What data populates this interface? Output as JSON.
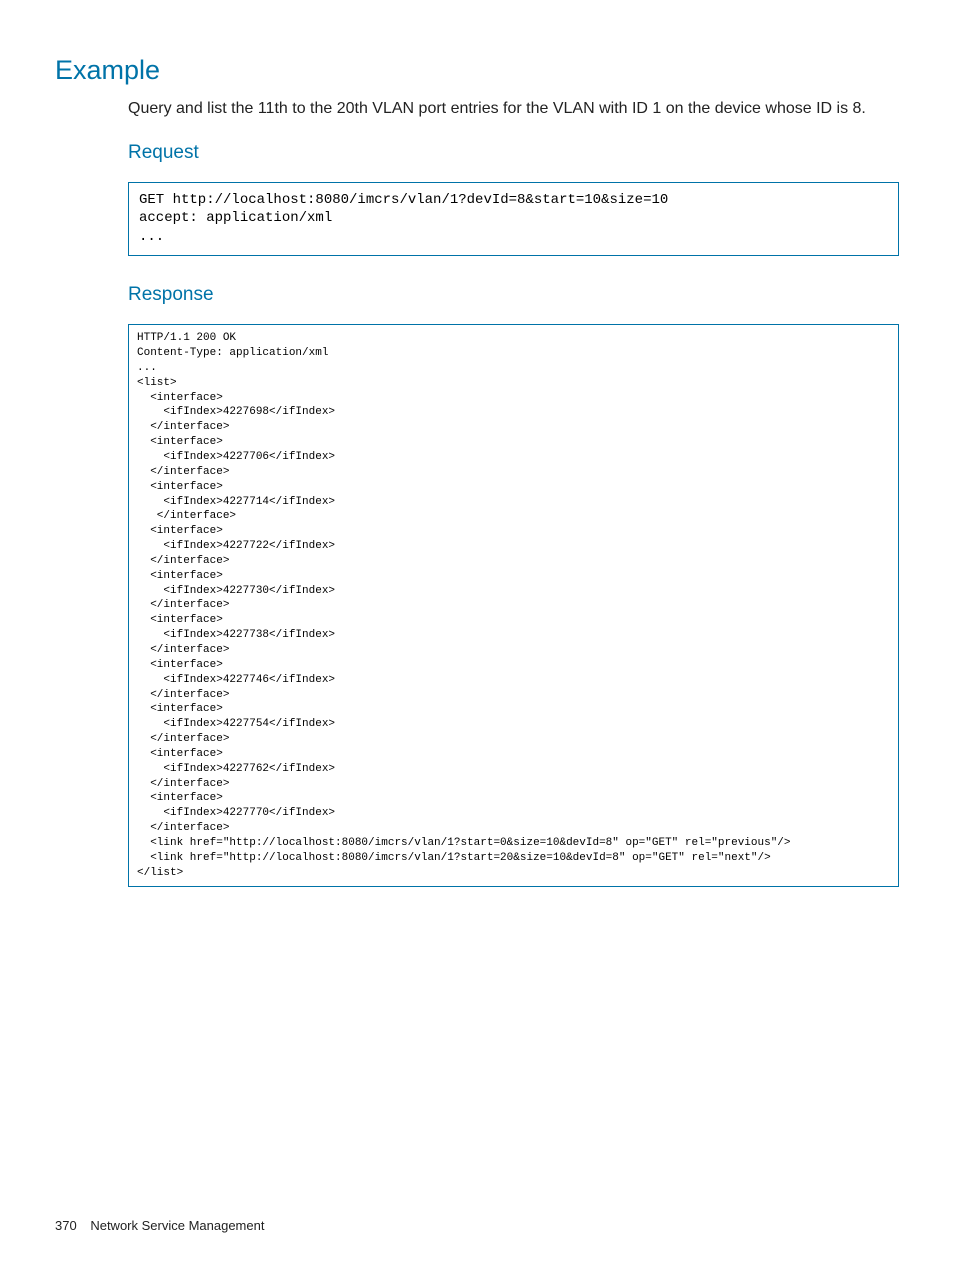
{
  "headings": {
    "example": "Example",
    "request": "Request",
    "response": "Response"
  },
  "example_description": "Query and list the 11th to the 20th VLAN port entries for the VLAN with ID 1 on the device whose ID is 8.",
  "request_code": "GET http://localhost:8080/imcrs/vlan/1?devId=8&start=10&size=10\naccept: application/xml\n...",
  "response_code": "HTTP/1.1 200 OK\nContent-Type: application/xml\n...\n<list>\n  <interface>\n    <ifIndex>4227698</ifIndex>\n  </interface>\n  <interface>\n    <ifIndex>4227706</ifIndex>\n  </interface>\n  <interface>\n    <ifIndex>4227714</ifIndex>\n   </interface>\n  <interface>\n    <ifIndex>4227722</ifIndex>\n  </interface>\n  <interface>\n    <ifIndex>4227730</ifIndex>\n  </interface>\n  <interface>\n    <ifIndex>4227738</ifIndex>\n  </interface>\n  <interface>\n    <ifIndex>4227746</ifIndex>\n  </interface>\n  <interface>\n    <ifIndex>4227754</ifIndex>\n  </interface>\n  <interface>\n    <ifIndex>4227762</ifIndex>\n  </interface>\n  <interface>\n    <ifIndex>4227770</ifIndex>\n  </interface>\n  <link href=\"http://localhost:8080/imcrs/vlan/1?start=0&size=10&devId=8\" op=\"GET\" rel=\"previous\"/>\n  <link href=\"http://localhost:8080/imcrs/vlan/1?start=20&size=10&devId=8\" op=\"GET\" rel=\"next\"/>\n</list>",
  "footer": {
    "page_number": "370",
    "section_title": "Network Service Management"
  }
}
